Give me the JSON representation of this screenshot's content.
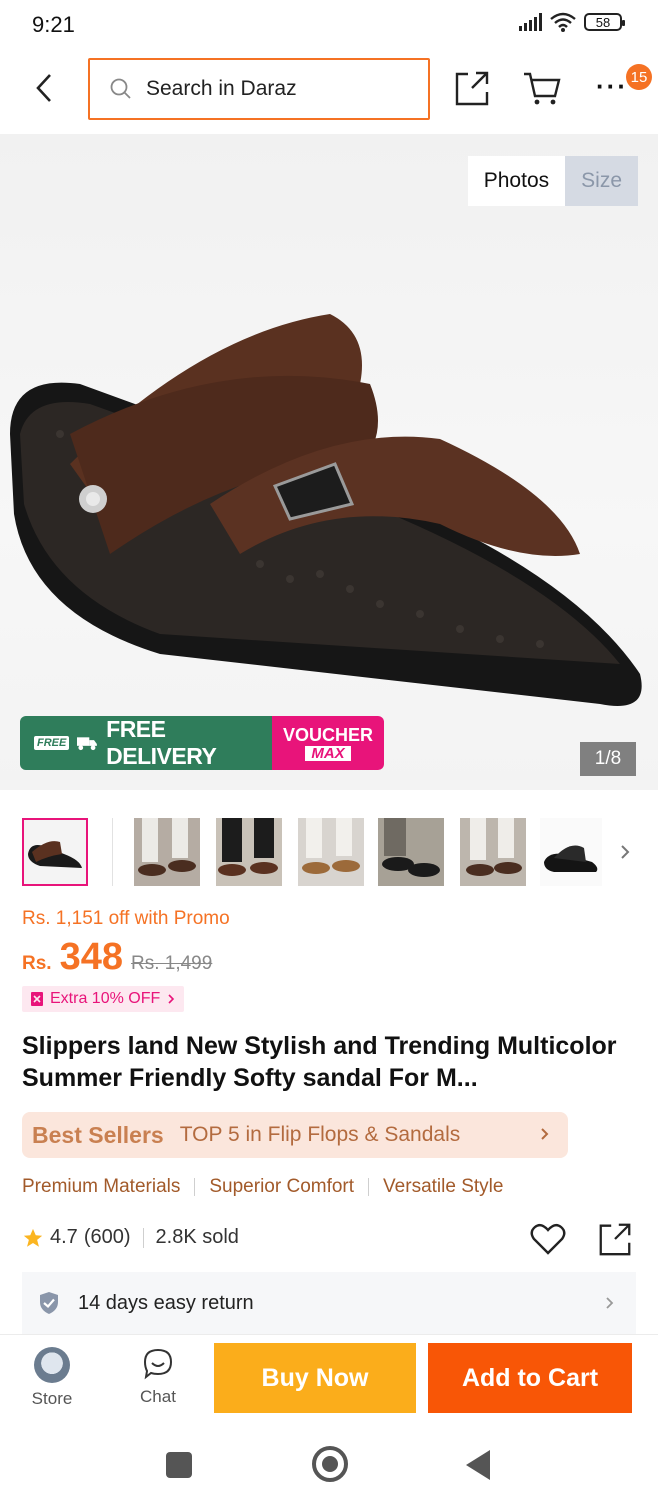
{
  "status_bar": {
    "time": "9:21",
    "battery": "58"
  },
  "header": {
    "search_placeholder": "Search in Daraz",
    "cart_badge": "15"
  },
  "gallery": {
    "tabs": [
      "Photos",
      "Size"
    ],
    "page_counter": "1/8",
    "delivery_banner": {
      "free_tag": "FREE",
      "text": "FREE DELIVERY",
      "voucher": "VOUCHER",
      "max": "MAX"
    },
    "thumbnail_count": 7
  },
  "price": {
    "promo_text": "Rs. 1,151 off with Promo",
    "currency": "Rs.",
    "current": "348",
    "original": "Rs. 1,499",
    "extra_offer": "Extra 10% OFF"
  },
  "product": {
    "title": "Slippers land New Stylish and Trending Multicolor Summer Friendly Softy sandal For M..."
  },
  "best_sellers": {
    "label": "Best Sellers",
    "text": "TOP 5 in Flip Flops & Sandals"
  },
  "features": [
    "Premium Materials",
    "Superior Comfort",
    "Versatile Style"
  ],
  "rating": {
    "score": "4.7",
    "count": "(600)",
    "sold": "2.8K sold"
  },
  "return_policy": {
    "text": "14 days easy return"
  },
  "bottom_bar": {
    "store_label": "Store",
    "chat_label": "Chat",
    "buy_now": "Buy Now",
    "add_to_cart": "Add to Cart"
  },
  "colors": {
    "accent": "#f57224",
    "buy_now": "#fbad1b",
    "add_to_cart": "#f85606",
    "voucher_pink": "#e8147a",
    "delivery_green": "#2f7d5b"
  }
}
